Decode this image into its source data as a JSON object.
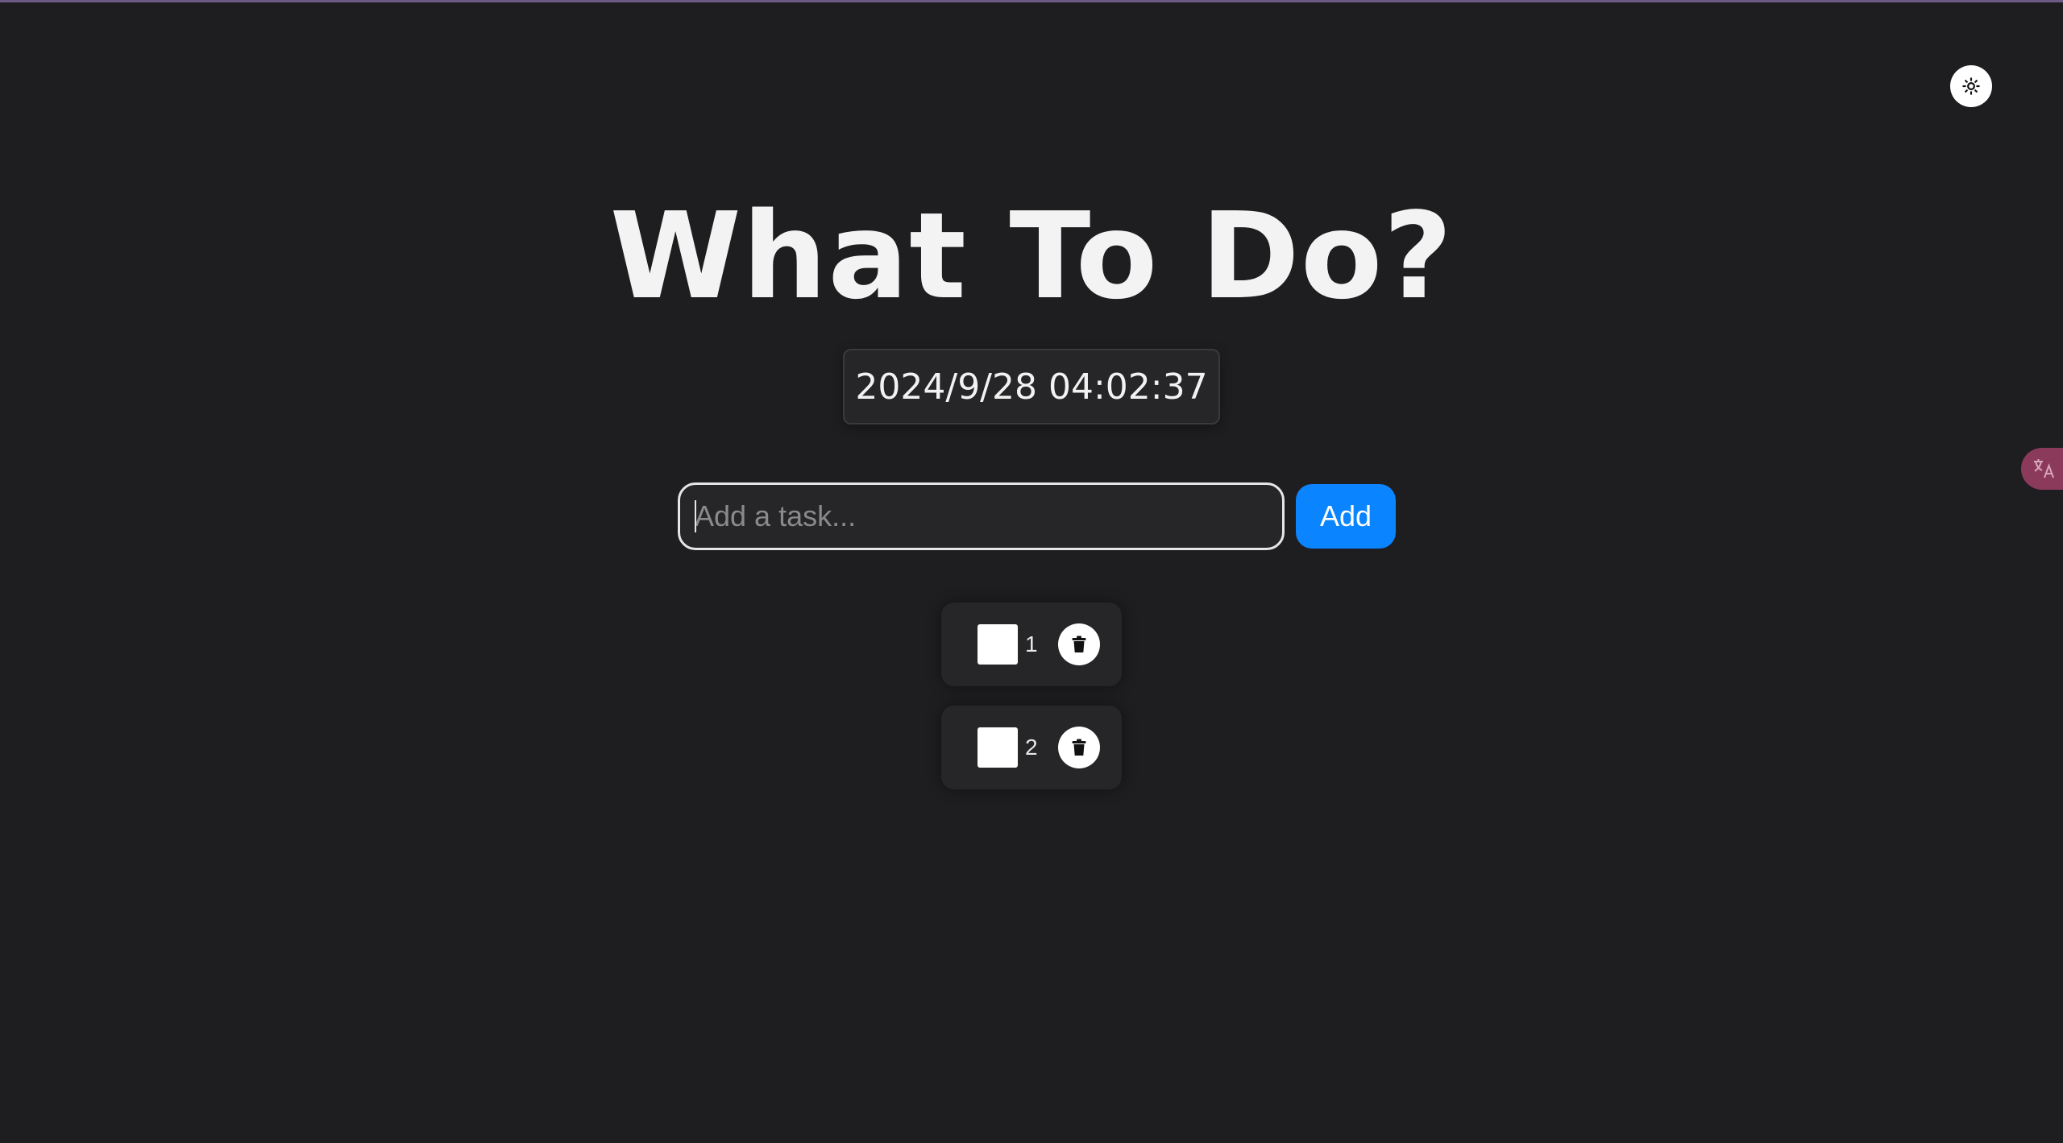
{
  "header": {
    "title": "What To Do?"
  },
  "clock": {
    "datetime": "2024/9/28 04:02:37"
  },
  "form": {
    "input_placeholder": "Add a task...",
    "input_value": "",
    "add_label": "Add"
  },
  "tasks": [
    {
      "label": "1",
      "completed": false
    },
    {
      "label": "2",
      "completed": false
    }
  ],
  "icons": {
    "theme_toggle": "sun-icon",
    "delete": "trash-icon",
    "translate": "translate-icon"
  },
  "colors": {
    "background": "#1e1e20",
    "accent": "#0a84ff",
    "card": "#262628",
    "text": "#f2f2f2"
  }
}
